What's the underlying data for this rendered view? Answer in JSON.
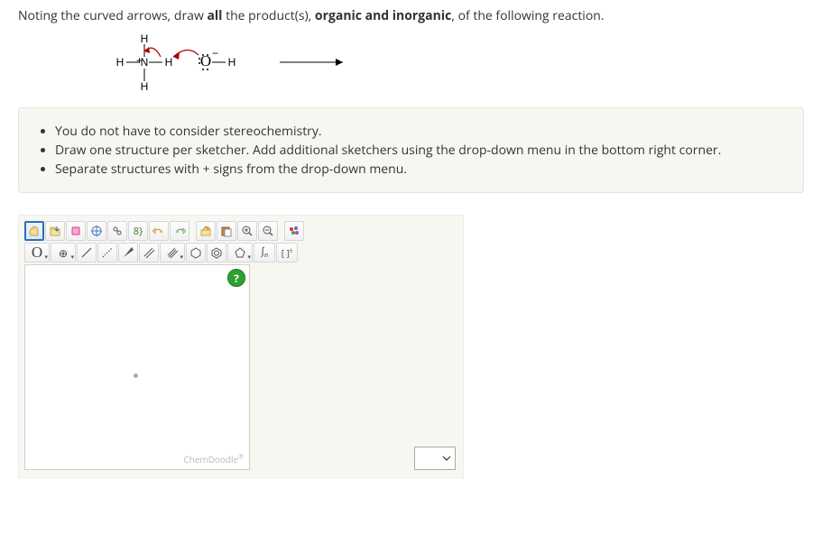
{
  "prompt": {
    "pre": "Noting the curved arrows, draw ",
    "bold1": "all",
    "mid": " the product(s), ",
    "bold2": "organic and inorganic",
    "post": ", of the following reaction."
  },
  "hints": [
    "You do not have to consider stereochemistry.",
    "Draw one structure per sketcher. Add additional sketchers using the drop-down menu in the bottom right corner.",
    "Separate structures with + signs from the drop-down menu."
  ],
  "sketcher": {
    "watermark": "ChemDoodle",
    "help": "?",
    "oxygen_label": "O",
    "tools": {
      "zoomin": "+",
      "zoomout": "−",
      "center": "⊕",
      "rotate": "⟳",
      "sn": "∫n",
      "brackets": "[ ]"
    }
  },
  "reaction": {
    "nh4": {
      "center": "N",
      "h": "H",
      "charge": "+"
    },
    "oh": {
      "o": "O",
      "h": "H",
      "charge": "−"
    }
  }
}
